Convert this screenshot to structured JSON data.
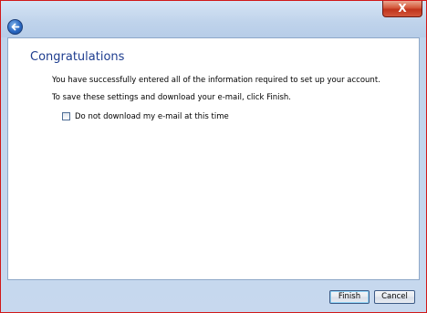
{
  "window": {
    "close_label": "X"
  },
  "wizard": {
    "heading": "Congratulations",
    "message_line1": "You have successfully entered all of the information required to set up your account.",
    "message_line2": "To save these settings and download your e-mail, click Finish.",
    "checkbox": {
      "label": "Do not download my e-mail at this time",
      "checked": false
    }
  },
  "footer": {
    "finish_label": "Finish",
    "cancel_label": "Cancel"
  },
  "icons": {
    "back": "back-arrow-icon",
    "close": "close-icon"
  },
  "colors": {
    "heading": "#1e3d8f",
    "window_border": "#d11818",
    "chrome": "#bfd4ec"
  }
}
